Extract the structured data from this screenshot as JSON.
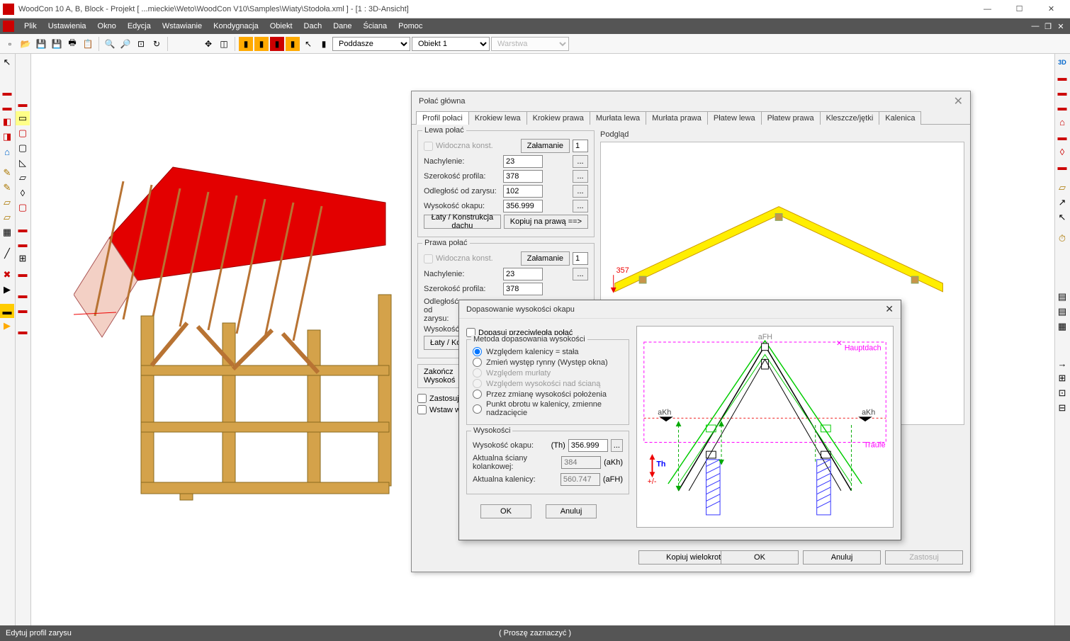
{
  "title": "WoodCon 10 A, B, Block - Projekt [ ...mieckie\\Weto\\WoodCon V10\\Samples\\Wiaty\\Stodoła.xml ]  - [1 : 3D-Ansicht]",
  "menu": [
    "Plik",
    "Ustawienia",
    "Okno",
    "Edycja",
    "Wstawianie",
    "Kondygnacja",
    "Obiekt",
    "Dach",
    "Dane",
    "Ściana",
    "Pomoc"
  ],
  "dropdowns": {
    "d1": "Poddasze",
    "d2": "Obiekt 1",
    "d3": "Warstwa"
  },
  "statusbar": {
    "left": "Edytuj profil zarysu",
    "center": "( Proszę zaznaczyć )"
  },
  "dialog1": {
    "title": "Połać główna",
    "tabs": [
      "Profil połaci",
      "Krokiew lewa",
      "Krokiew prawa",
      "Murłata lewa",
      "Murłata prawa",
      "Płatew lewa",
      "Płatew prawa",
      "Kleszcze/jętki",
      "Kalenica"
    ],
    "lewa": {
      "title": "Lewa połać",
      "widoczna": "Widoczna konst.",
      "zalamanie": "Załamanie",
      "nachylenie_l": "Nachylenie:",
      "nachylenie_v": "23",
      "szer_l": "Szerokość profila:",
      "szer_v": "378",
      "odl_l": "Odległość od zarysu:",
      "odl_v": "102",
      "wys_l": "Wysokość okapu:",
      "wys_v": "356.999",
      "laty": "Łaty / Konstrukcja dachu",
      "kopiuj": "Kopiuj na prawą ==>"
    },
    "prawa": {
      "title": "Prawa połać",
      "widoczna": "Widoczna konst.",
      "zalamanie": "Załamanie",
      "nachylenie_l": "Nachylenie:",
      "nachylenie_v": "23",
      "szer_l": "Szerokość profila:",
      "szer_v": "378",
      "odl_l": "Odległość od zarysu:",
      "wys_l": "Wysokość",
      "laty": "Łaty / Kon",
      "zakon": "Zakończ",
      "wysok": "Wysokoś"
    },
    "checks": {
      "zast": "Zastosuj",
      "wstaw": "Wstaw w"
    },
    "preview": "Podgląd",
    "preview_dim": "357",
    "buttons": {
      "copy": "Kopiuj wielokrotnie",
      "ok": "OK",
      "anuluj": "Anuluj",
      "zastosuj": "Zastosuj"
    }
  },
  "dialog2": {
    "title": "Dopasowanie wysokości okapu",
    "dopasuj": "Dopasuj przeciwległą połać",
    "metoda_title": "Metoda dopasowania wysokości",
    "radios": [
      "Względem kalenicy = stała",
      "Zmień występ rynny (Występ okna)",
      "Względem murłaty",
      "Względem wysokości nad ścianą",
      "Przez zmianę wysokości położenia",
      "Punkt obrotu w kalenicy, zmienne nadzacięcie"
    ],
    "wys_title": "Wysokości",
    "wys_okapu_l": "Wysokość okapu:",
    "wys_okapu_abbr": "(Th)",
    "wys_okapu_v": "356.999",
    "akt_sciany_l": "Aktualna ściany kolankowej:",
    "akt_sciany_v": "384",
    "akt_sciany_abbr": "(aKh)",
    "akt_kal_l": "Aktualna kalenicy:",
    "akt_kal_v": "560.747",
    "akt_kal_abbr": "(aFH)",
    "ok": "OK",
    "anuluj": "Anuluj",
    "diagram": {
      "aFH": "aFH",
      "aKh": "aKh",
      "Th": "Th",
      "plusminus": "+/-",
      "haupt": "Hauptdach",
      "traufe": "Traufe"
    }
  }
}
